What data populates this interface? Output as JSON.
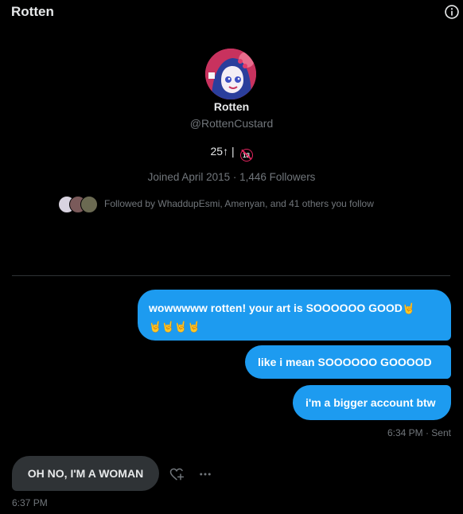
{
  "header": {
    "title": "Rotten",
    "info_icon": "info-icon"
  },
  "profile": {
    "avatar_icon": "anime-avatar",
    "name": "Rotten",
    "handle": "@RottenCustard",
    "bio_prefix": "25↑ | ",
    "bio_badge": "18",
    "meta": "Joined April 2015 · 1,446 Followers",
    "followed_by": "Followed by WhaddupEsmi, Amenyan, and 41 others you follow"
  },
  "messages": {
    "sent": [
      {
        "line1": "wowwwww rotten! your art is SOOOOOO GOOD",
        "emoji_line1": "🤘",
        "emoji_line2": "🤘🤘🤘🤘"
      },
      {
        "text": "like i mean SOOOOOO GOOOOD"
      },
      {
        "text": "i'm a bigger account btw"
      }
    ],
    "sent_status": "6:34 PM · Sent",
    "received": [
      {
        "text": "OH NO, I'M A WOMAN",
        "time": "6:37 PM"
      }
    ]
  },
  "colors": {
    "accent": "#1d9bf0",
    "received_bubble": "#2f3336",
    "muted": "#71767b",
    "background": "#000000"
  }
}
